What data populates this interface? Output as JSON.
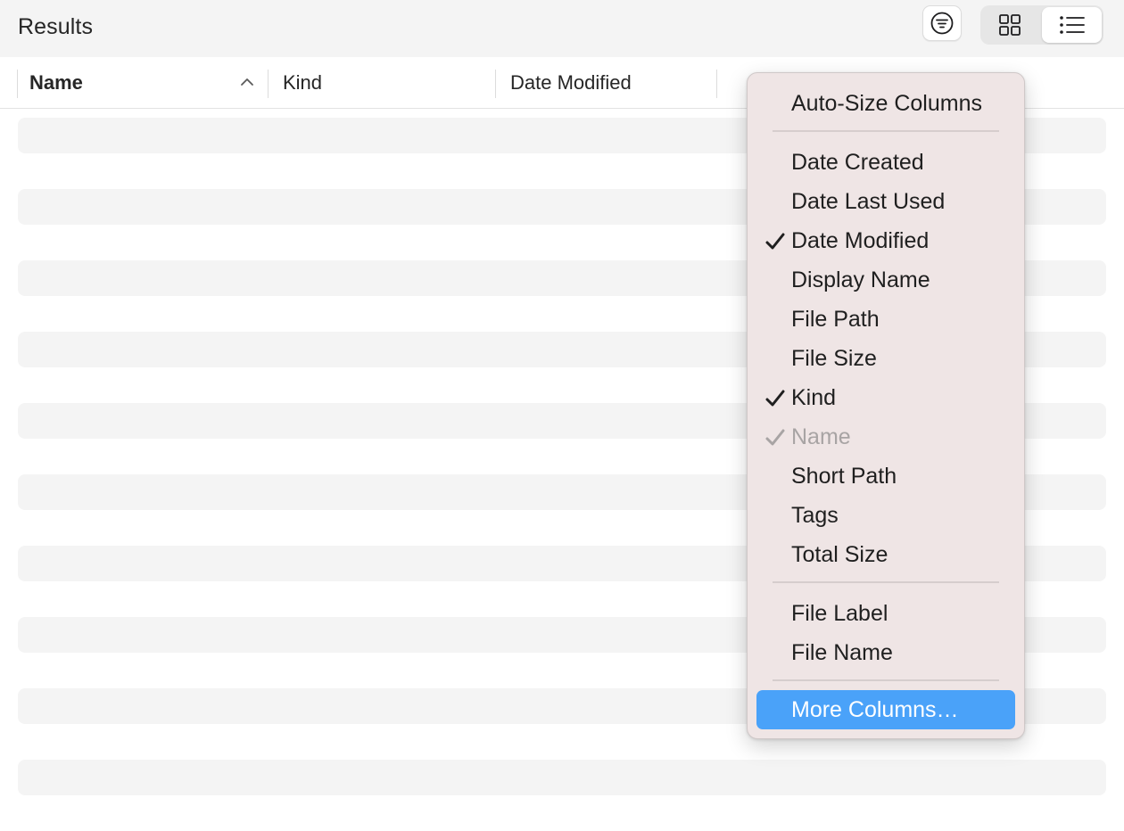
{
  "header": {
    "title": "Results",
    "filter_icon": "filter-icon",
    "view_toggle": {
      "grid_icon": "grid-view-icon",
      "list_icon": "list-view-icon",
      "selected": "list"
    }
  },
  "columns": [
    {
      "label": "Name",
      "sorted": "ascending"
    },
    {
      "label": "Kind"
    },
    {
      "label": "Date Modified"
    }
  ],
  "context_menu": {
    "sections": [
      [
        {
          "label": "Auto-Size Columns",
          "checked": false,
          "disabled": false
        }
      ],
      [
        {
          "label": "Date Created",
          "checked": false,
          "disabled": false
        },
        {
          "label": "Date Last Used",
          "checked": false,
          "disabled": false
        },
        {
          "label": "Date Modified",
          "checked": true,
          "disabled": false
        },
        {
          "label": "Display Name",
          "checked": false,
          "disabled": false
        },
        {
          "label": "File Path",
          "checked": false,
          "disabled": false
        },
        {
          "label": "File Size",
          "checked": false,
          "disabled": false
        },
        {
          "label": "Kind",
          "checked": true,
          "disabled": false
        },
        {
          "label": "Name",
          "checked": true,
          "disabled": true
        },
        {
          "label": "Short Path",
          "checked": false,
          "disabled": false
        },
        {
          "label": "Tags",
          "checked": false,
          "disabled": false
        },
        {
          "label": "Total Size",
          "checked": false,
          "disabled": false
        }
      ],
      [
        {
          "label": "File Label",
          "checked": false,
          "disabled": false
        },
        {
          "label": "File Name",
          "checked": false,
          "disabled": false
        }
      ],
      [
        {
          "label": "More Columns…",
          "checked": false,
          "disabled": false,
          "highlighted": true
        }
      ]
    ]
  },
  "colors": {
    "menu_background": "#efe5e5",
    "highlight": "#4aa2f9",
    "row_placeholder": "#f4f4f4",
    "header_background": "#f4f4f4"
  }
}
